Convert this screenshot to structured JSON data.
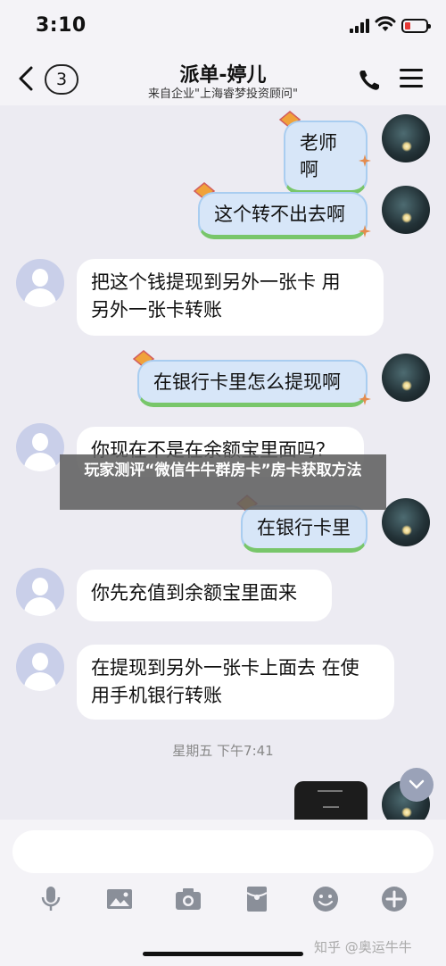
{
  "status_bar": {
    "time": "3:10"
  },
  "header": {
    "back_badge": "3",
    "title": "派单-婷儿",
    "subtitle": "来自企业\"上海睿梦投资顾问\""
  },
  "messages": [
    {
      "side": "right",
      "text": "老师啊"
    },
    {
      "side": "right",
      "text": "这个转不出去啊"
    },
    {
      "side": "left",
      "lines": [
        "把这个钱提现到另外一张卡  用",
        "另外一张卡转账"
      ]
    },
    {
      "side": "right",
      "text": "在银行卡里怎么提现啊"
    },
    {
      "side": "left",
      "text": "你现在不是在余额宝里面吗？"
    },
    {
      "side": "right",
      "text": "在银行卡里"
    },
    {
      "side": "left",
      "text": "你先充值到余额宝里面来"
    },
    {
      "side": "left",
      "lines": [
        "在提现到另外一张卡上面去 在使",
        "用手机银行转账"
      ]
    }
  ],
  "time_separator": "星期五 下午7:41",
  "overlay_banner": "玩家测评“微信牛牛群房卡”房卡获取方法",
  "input": {
    "value": ""
  },
  "toolbar": [
    "mic-icon",
    "image-icon",
    "camera-icon",
    "red-packet-icon",
    "emoji-icon",
    "plus-icon"
  ],
  "watermark": "知乎 @奥运牛牛",
  "colors": {
    "background": "#ecebf2",
    "bubble_left": "#ffffff",
    "bubble_right": "#d7e6f8",
    "bubble_right_accent": "#78c66a",
    "avatar_user": "#c9cfe9"
  }
}
